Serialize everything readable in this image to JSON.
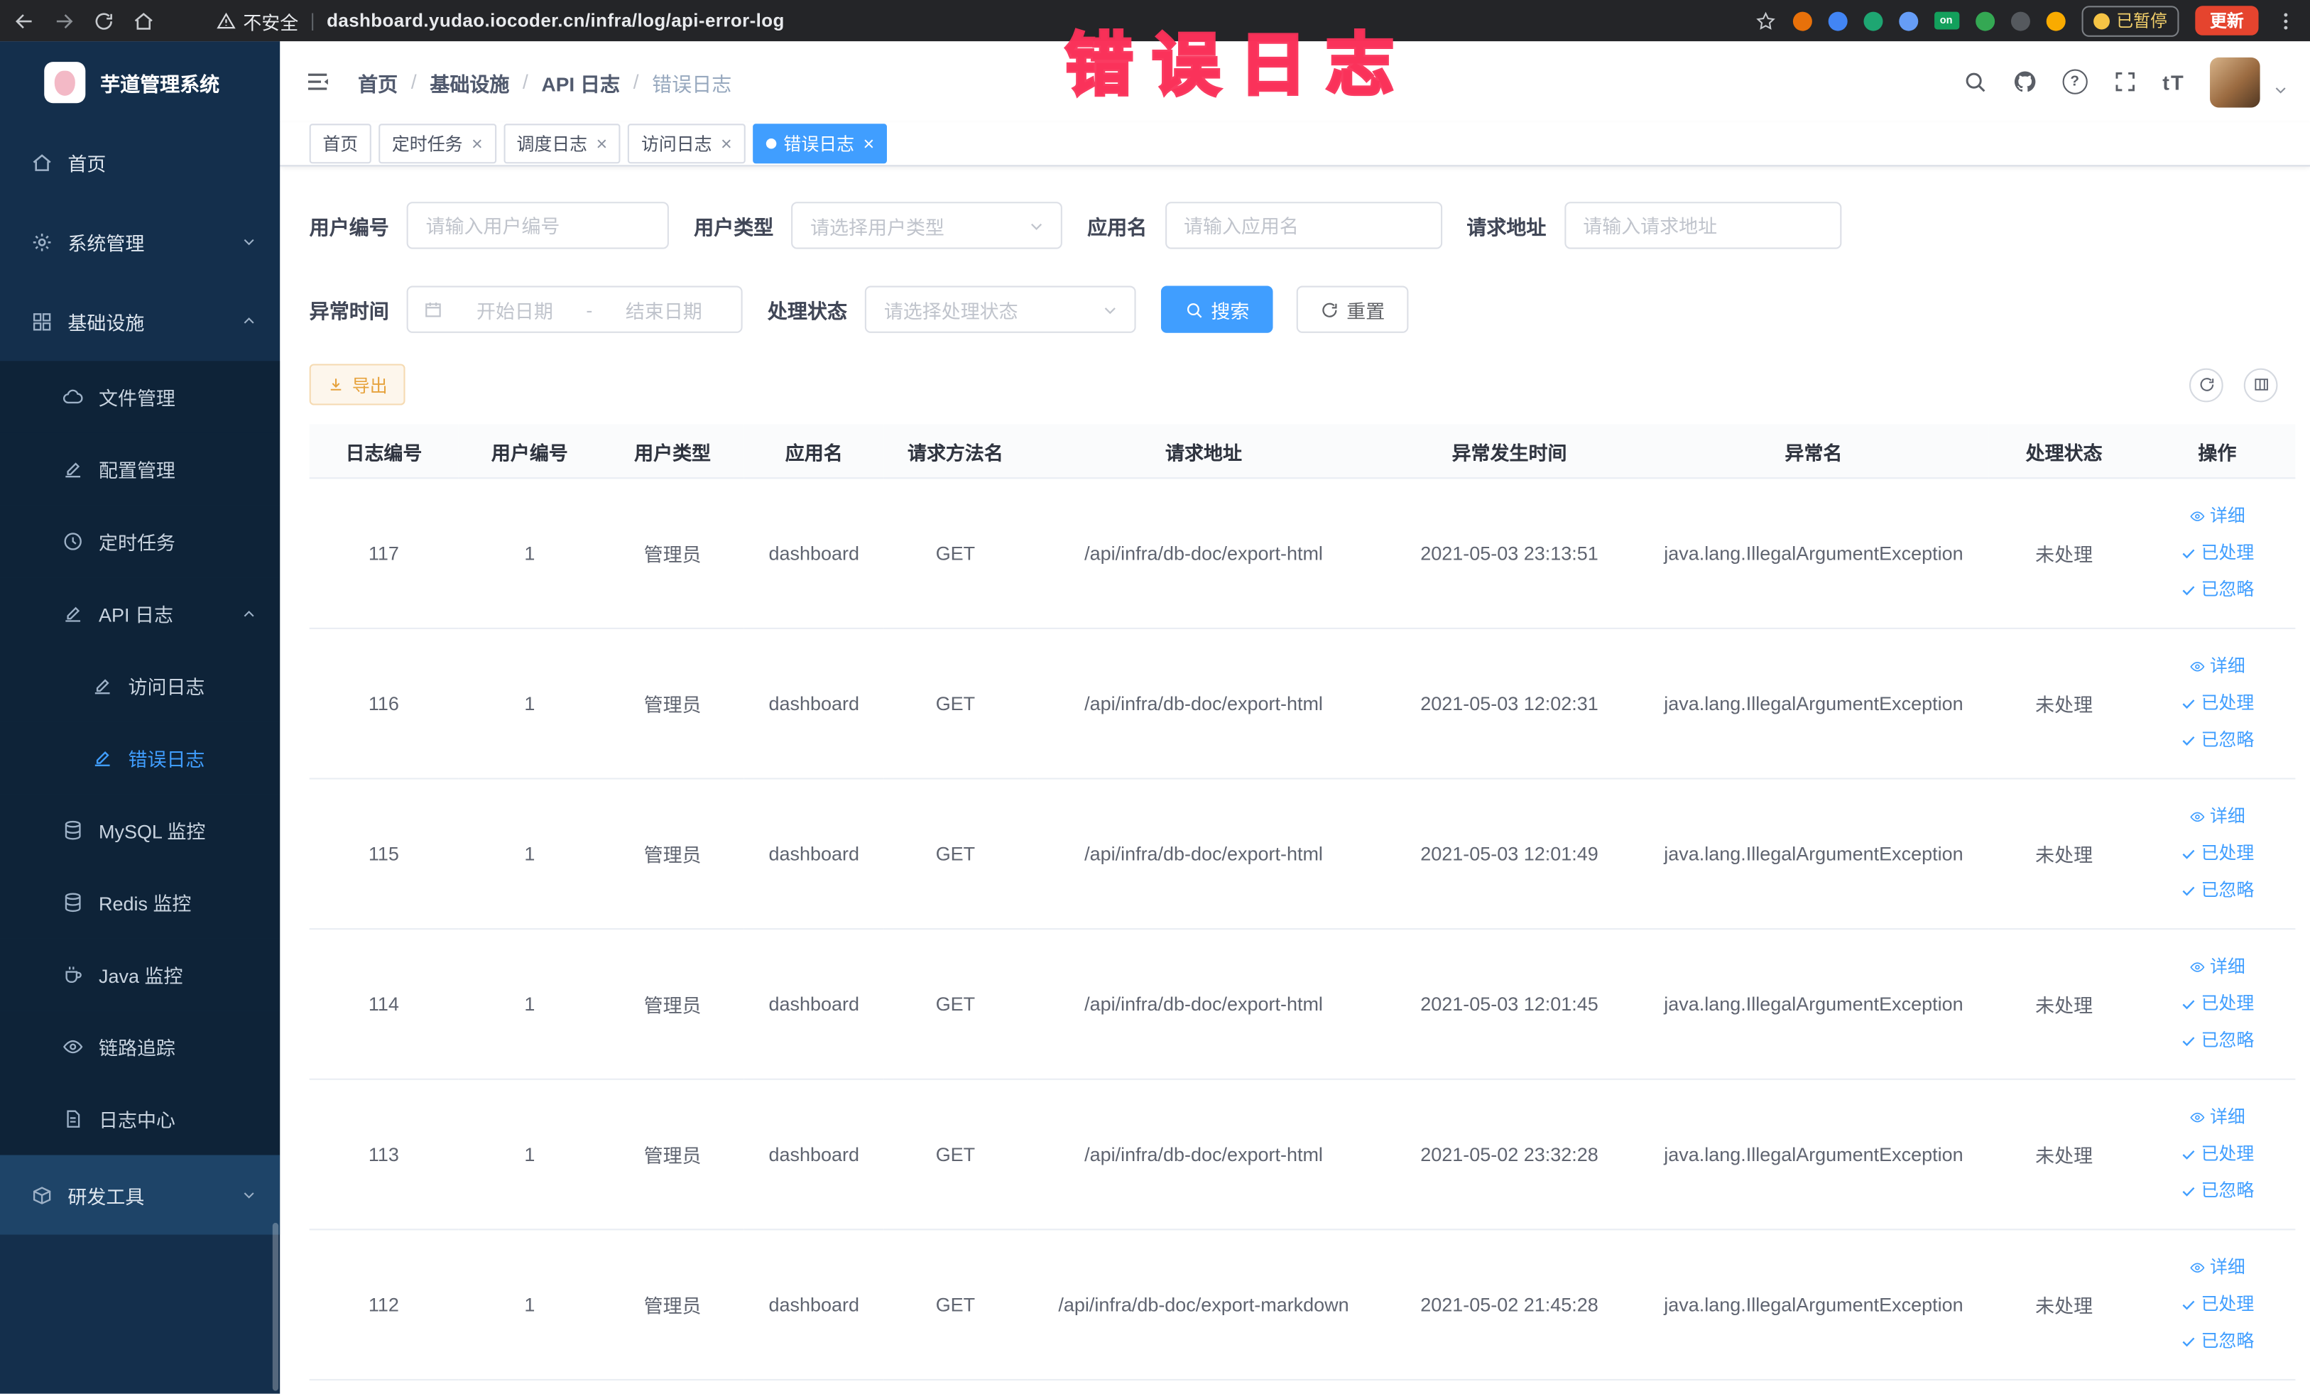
{
  "icons": {
    "divider": "|",
    "breadcrumb_sep": "/",
    "close": "×",
    "question": "?",
    "font_size": "tT",
    "extension_on_label": "on"
  },
  "browser": {
    "security_label": "不安全",
    "url": "dashboard.yudao.iocoder.cn/infra/log/api-error-log",
    "paused_badge": "已暂停",
    "update_button": "更新"
  },
  "sidebar": {
    "logo_title": "芋道管理系统",
    "items": [
      {
        "label": "首页",
        "level": 1,
        "icon": "home"
      },
      {
        "label": "系统管理",
        "level": 1,
        "icon": "gear",
        "chevron": "down"
      },
      {
        "label": "基础设施",
        "level": 1,
        "icon": "grid",
        "chevron": "up",
        "expanded": true
      },
      {
        "label": "文件管理",
        "level": 2,
        "icon": "cloud"
      },
      {
        "label": "配置管理",
        "level": 2,
        "icon": "edit"
      },
      {
        "label": "定时任务",
        "level": 2,
        "icon": "clock"
      },
      {
        "label": "API 日志",
        "level": 2,
        "icon": "edit",
        "chevron": "up",
        "expanded": true
      },
      {
        "label": "访问日志",
        "level": 3,
        "icon": "edit"
      },
      {
        "label": "错误日志",
        "level": 3,
        "icon": "edit",
        "active": true
      },
      {
        "label": "MySQL 监控",
        "level": 2,
        "icon": "db"
      },
      {
        "label": "Redis 监控",
        "level": 2,
        "icon": "db"
      },
      {
        "label": "Java 监控",
        "level": 2,
        "icon": "cup"
      },
      {
        "label": "链路追踪",
        "level": 2,
        "icon": "eye"
      },
      {
        "label": "日志中心",
        "level": 2,
        "icon": "doc"
      },
      {
        "label": "研发工具",
        "level": 1,
        "icon": "box",
        "chevron": "down"
      }
    ]
  },
  "header": {
    "breadcrumb": [
      "首页",
      "基础设施",
      "API 日志",
      "错误日志"
    ],
    "annotation": "错误日志"
  },
  "tabs": [
    {
      "label": "首页",
      "closable": false,
      "active": false
    },
    {
      "label": "定时任务",
      "closable": true,
      "active": false
    },
    {
      "label": "调度日志",
      "closable": true,
      "active": false
    },
    {
      "label": "访问日志",
      "closable": true,
      "active": false
    },
    {
      "label": "错误日志",
      "closable": true,
      "active": true
    }
  ],
  "filters": {
    "user_id": {
      "label": "用户编号",
      "placeholder": "请输入用户编号"
    },
    "user_type": {
      "label": "用户类型",
      "placeholder": "请选择用户类型"
    },
    "app_name": {
      "label": "应用名",
      "placeholder": "请输入应用名"
    },
    "request_url": {
      "label": "请求地址",
      "placeholder": "请输入请求地址"
    },
    "exception_time": {
      "label": "异常时间",
      "start_placeholder": "开始日期",
      "separator": "-",
      "end_placeholder": "结束日期"
    },
    "process_status": {
      "label": "处理状态",
      "placeholder": "请选择处理状态"
    },
    "search_button": "搜索",
    "reset_button": "重置"
  },
  "toolbar": {
    "export_button": "导出"
  },
  "table": {
    "columns": [
      "日志编号",
      "用户编号",
      "用户类型",
      "应用名",
      "请求方法名",
      "请求地址",
      "异常发生时间",
      "异常名",
      "处理状态",
      "操作"
    ],
    "actions": {
      "detail": "详细",
      "processed": "已处理",
      "ignored": "已忽略"
    },
    "rows": [
      {
        "log_id": "117",
        "user_id": "1",
        "user_type": "管理员",
        "app_name": "dashboard",
        "method": "GET",
        "request_url": "/api/infra/db-doc/export-html",
        "time": "2021-05-03 23:13:51",
        "exception_name": "java.lang.IllegalArgumentException",
        "status": "未处理"
      },
      {
        "log_id": "116",
        "user_id": "1",
        "user_type": "管理员",
        "app_name": "dashboard",
        "method": "GET",
        "request_url": "/api/infra/db-doc/export-html",
        "time": "2021-05-03 12:02:31",
        "exception_name": "java.lang.IllegalArgumentException",
        "status": "未处理"
      },
      {
        "log_id": "115",
        "user_id": "1",
        "user_type": "管理员",
        "app_name": "dashboard",
        "method": "GET",
        "request_url": "/api/infra/db-doc/export-html",
        "time": "2021-05-03 12:01:49",
        "exception_name": "java.lang.IllegalArgumentException",
        "status": "未处理"
      },
      {
        "log_id": "114",
        "user_id": "1",
        "user_type": "管理员",
        "app_name": "dashboard",
        "method": "GET",
        "request_url": "/api/infra/db-doc/export-html",
        "time": "2021-05-03 12:01:45",
        "exception_name": "java.lang.IllegalArgumentException",
        "status": "未处理"
      },
      {
        "log_id": "113",
        "user_id": "1",
        "user_type": "管理员",
        "app_name": "dashboard",
        "method": "GET",
        "request_url": "/api/infra/db-doc/export-html",
        "time": "2021-05-02 23:32:28",
        "exception_name": "java.lang.IllegalArgumentException",
        "status": "未处理"
      },
      {
        "log_id": "112",
        "user_id": "1",
        "user_type": "管理员",
        "app_name": "dashboard",
        "method": "GET",
        "request_url": "/api/infra/db-doc/export-markdown",
        "time": "2021-05-02 21:45:28",
        "exception_name": "java.lang.IllegalArgumentException",
        "status": "未处理"
      }
    ]
  }
}
